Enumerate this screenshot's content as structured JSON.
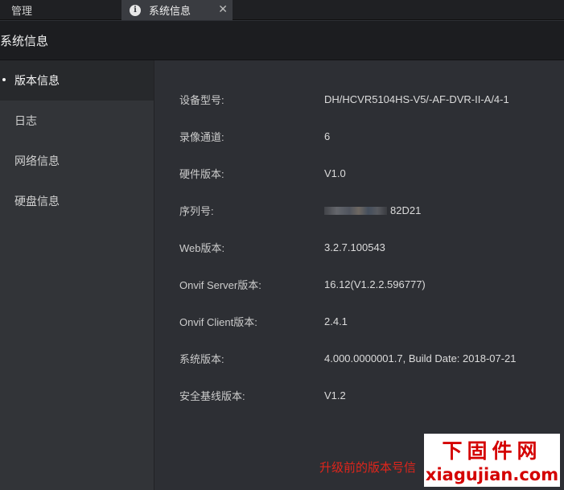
{
  "tabs": {
    "manage": "管理",
    "sysinfo": "系统信息",
    "close": "✕"
  },
  "header": {
    "title": "系统信息"
  },
  "sidebar": {
    "items": [
      {
        "label": "版本信息",
        "active": true
      },
      {
        "label": "日志"
      },
      {
        "label": "网络信息"
      },
      {
        "label": "硬盘信息"
      }
    ]
  },
  "info": [
    {
      "label": "设备型号:",
      "value": "DH/HCVR5104HS-V5/-AF-DVR-II-A/4-1"
    },
    {
      "label": "录像通道:",
      "value": "6"
    },
    {
      "label": "硬件版本:",
      "value": "V1.0"
    },
    {
      "label": "序列号:",
      "value": "82D21"
    },
    {
      "label": "Web版本:",
      "value": "3.2.7.100543"
    },
    {
      "label": "Onvif Server版本:",
      "value": "16.12(V1.2.2.596777)"
    },
    {
      "label": "Onvif Client版本:",
      "value": "2.4.1"
    },
    {
      "label": "系统版本:",
      "value": "4.000.0000001.7, Build Date: 2018-07-21"
    },
    {
      "label": "安全基线版本:",
      "value": "V1.2"
    }
  ],
  "note": "升级前的版本号信",
  "watermark": {
    "line1": "下固件网",
    "line2": "xiagujian.com"
  }
}
